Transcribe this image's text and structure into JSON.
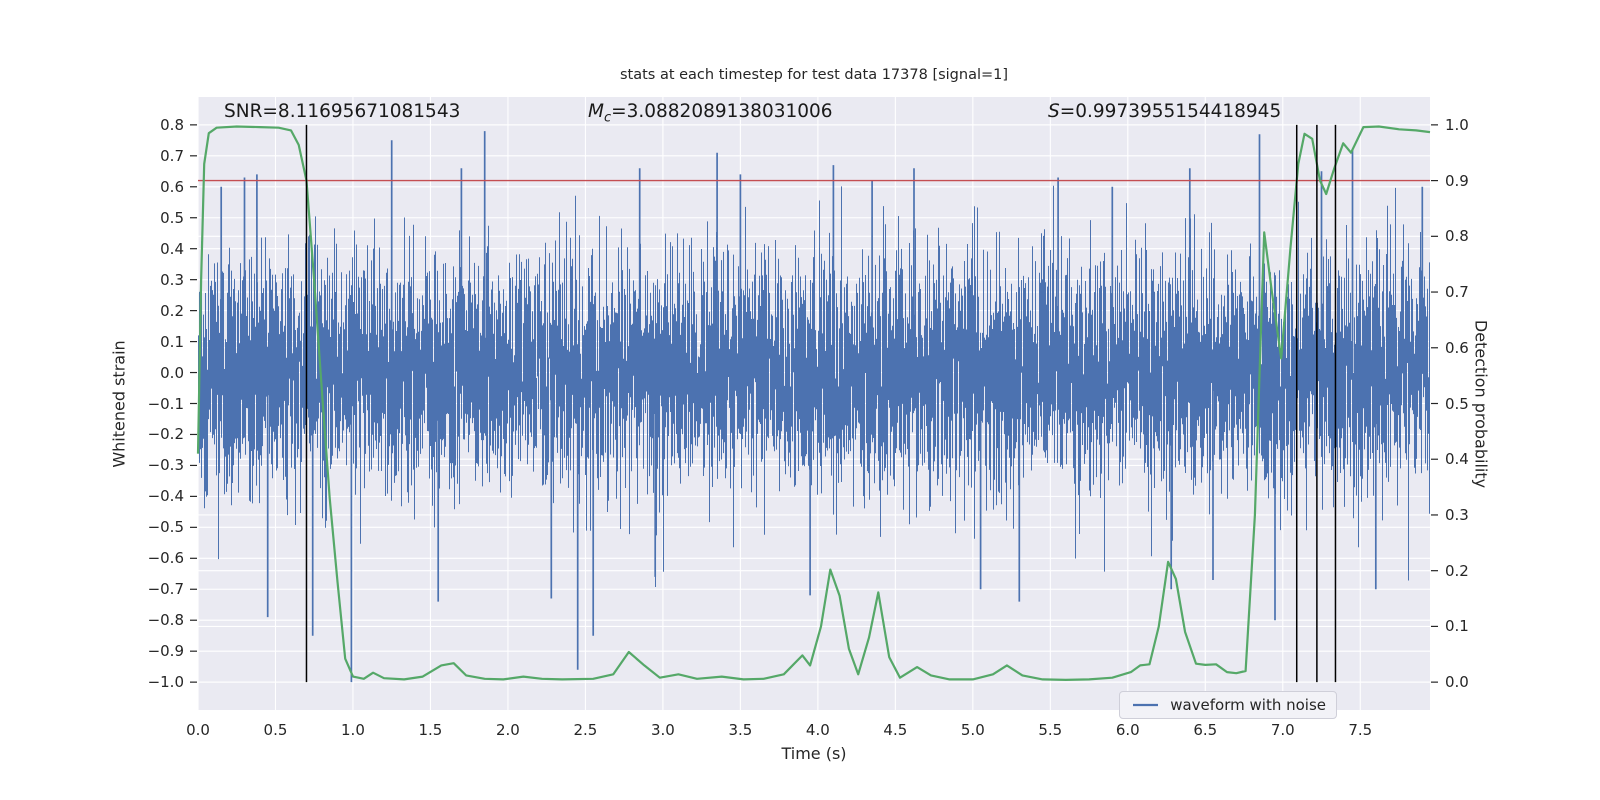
{
  "figure": {
    "title": "stats at each timestep for test data 17378 [signal=1]"
  },
  "annotations": {
    "snr": "SNR=8.11695671081543",
    "mc_symbol": "M",
    "mc_subscript": "c",
    "mc_value": "=3.0882089138031006",
    "s_symbol": "S",
    "s_value": "=0.9973955154418945"
  },
  "axes": {
    "xlabel": "Time (s)",
    "ylabel_left": "Whitened strain",
    "ylabel_right": "Detection probability",
    "xtick_labels": [
      "0.0",
      "0.5",
      "1.0",
      "1.5",
      "2.0",
      "2.5",
      "3.0",
      "3.5",
      "4.0",
      "4.5",
      "5.0",
      "5.5",
      "6.0",
      "6.5",
      "7.0",
      "7.5"
    ],
    "left_tick_labels": [
      "0.8",
      "0.7",
      "0.6",
      "0.5",
      "0.4",
      "0.3",
      "0.2",
      "0.1",
      "0.0",
      "−0.1",
      "−0.2",
      "−0.3",
      "−0.4",
      "−0.5",
      "−0.6",
      "−0.7",
      "−0.8",
      "−0.9",
      "−1.0"
    ],
    "right_tick_labels": [
      "1.0",
      "0.9",
      "0.8",
      "0.7",
      "0.6",
      "0.5",
      "0.4",
      "0.3",
      "0.2",
      "0.1",
      "0.0"
    ]
  },
  "legend": {
    "label": "waveform with noise"
  },
  "colors": {
    "figure_background": "#ffffff",
    "axes_background": "#eaeaf2",
    "grid": "#ffffff",
    "noise": "#4c72b0",
    "probability": "#55a868",
    "threshold": "#c44e52",
    "marker": "#000000",
    "text": "#262626"
  },
  "chart_data": {
    "type": "line",
    "title": "stats at each timestep for test data 17378 [signal=1]",
    "xlabel": "Time (s)",
    "ylabel_left": "Whitened strain",
    "ylabel_right": "Detection probability",
    "xlim": [
      0,
      7.95
    ],
    "ylim_left": [
      -1.09,
      0.89
    ],
    "ylim_right": [
      -0.05,
      1.05
    ],
    "grid": true,
    "legend_position": "lower right",
    "stats": {
      "SNR": 8.11695671081543,
      "chirp_mass": 3.0882089138031006,
      "score": 0.9973955154418945,
      "signal": 1,
      "test_data_id": 17378
    },
    "threshold_line": {
      "name": "detection threshold",
      "axis": "right",
      "y": 0.9
    },
    "event_markers": {
      "name": "event markers",
      "axis": "right",
      "x_values": [
        0.7,
        7.09,
        7.22,
        7.34
      ],
      "y_span": [
        0.0,
        1.0
      ]
    },
    "noise_series": {
      "name": "waveform with noise",
      "axis": "left",
      "style": "dense-gaussian-noise",
      "mean": 0,
      "approx_std": 0.185,
      "range": [
        -1.0,
        0.8
      ],
      "samples_per_column": 6,
      "seed": 17378,
      "notable_spikes": [
        [
          0.15,
          0.6
        ],
        [
          0.3,
          0.63
        ],
        [
          0.38,
          0.64
        ],
        [
          0.45,
          -0.79
        ],
        [
          0.74,
          -0.85
        ],
        [
          0.99,
          -1.0
        ],
        [
          1.25,
          0.75
        ],
        [
          1.55,
          -0.74
        ],
        [
          1.7,
          0.66
        ],
        [
          1.85,
          0.78
        ],
        [
          2.28,
          -0.73
        ],
        [
          2.45,
          -0.96
        ],
        [
          2.55,
          -0.85
        ],
        [
          2.85,
          0.66
        ],
        [
          2.95,
          -0.66
        ],
        [
          3.35,
          0.71
        ],
        [
          3.5,
          0.64
        ],
        [
          3.95,
          -0.72
        ],
        [
          4.1,
          0.67
        ],
        [
          4.35,
          0.62
        ],
        [
          4.62,
          0.66
        ],
        [
          5.05,
          -0.7
        ],
        [
          5.3,
          -0.74
        ],
        [
          5.55,
          0.63
        ],
        [
          5.9,
          0.6
        ],
        [
          6.28,
          -0.7
        ],
        [
          6.4,
          0.66
        ],
        [
          6.55,
          -0.67
        ],
        [
          6.85,
          0.77
        ],
        [
          6.95,
          -0.8
        ],
        [
          7.25,
          0.65
        ],
        [
          7.45,
          0.72
        ],
        [
          7.6,
          -0.7
        ],
        [
          7.9,
          0.6
        ]
      ]
    },
    "probability_series": {
      "name": "detection probability",
      "axis": "right",
      "points": [
        [
          0.0,
          0.41
        ],
        [
          0.02,
          0.72
        ],
        [
          0.04,
          0.93
        ],
        [
          0.07,
          0.985
        ],
        [
          0.12,
          0.995
        ],
        [
          0.25,
          0.997
        ],
        [
          0.4,
          0.996
        ],
        [
          0.52,
          0.995
        ],
        [
          0.6,
          0.99
        ],
        [
          0.65,
          0.964
        ],
        [
          0.7,
          0.9
        ],
        [
          0.75,
          0.72
        ],
        [
          0.8,
          0.52
        ],
        [
          0.85,
          0.33
        ],
        [
          0.9,
          0.18
        ],
        [
          0.95,
          0.042
        ],
        [
          1.0,
          0.01
        ],
        [
          1.07,
          0.006
        ],
        [
          1.13,
          0.017
        ],
        [
          1.2,
          0.007
        ],
        [
          1.33,
          0.005
        ],
        [
          1.45,
          0.01
        ],
        [
          1.57,
          0.03
        ],
        [
          1.65,
          0.034
        ],
        [
          1.73,
          0.012
        ],
        [
          1.85,
          0.006
        ],
        [
          1.97,
          0.005
        ],
        [
          2.1,
          0.01
        ],
        [
          2.22,
          0.006
        ],
        [
          2.35,
          0.005
        ],
        [
          2.55,
          0.006
        ],
        [
          2.68,
          0.014
        ],
        [
          2.78,
          0.054
        ],
        [
          2.88,
          0.03
        ],
        [
          2.98,
          0.008
        ],
        [
          3.1,
          0.014
        ],
        [
          3.22,
          0.006
        ],
        [
          3.38,
          0.01
        ],
        [
          3.52,
          0.005
        ],
        [
          3.65,
          0.006
        ],
        [
          3.78,
          0.014
        ],
        [
          3.9,
          0.048
        ],
        [
          3.95,
          0.03
        ],
        [
          4.02,
          0.1
        ],
        [
          4.08,
          0.202
        ],
        [
          4.14,
          0.155
        ],
        [
          4.2,
          0.06
        ],
        [
          4.26,
          0.014
        ],
        [
          4.33,
          0.08
        ],
        [
          4.39,
          0.161
        ],
        [
          4.46,
          0.045
        ],
        [
          4.53,
          0.008
        ],
        [
          4.64,
          0.027
        ],
        [
          4.73,
          0.012
        ],
        [
          4.85,
          0.005
        ],
        [
          5.0,
          0.005
        ],
        [
          5.13,
          0.014
        ],
        [
          5.22,
          0.03
        ],
        [
          5.32,
          0.012
        ],
        [
          5.45,
          0.005
        ],
        [
          5.6,
          0.004
        ],
        [
          5.75,
          0.005
        ],
        [
          5.9,
          0.008
        ],
        [
          6.02,
          0.018
        ],
        [
          6.08,
          0.03
        ],
        [
          6.14,
          0.032
        ],
        [
          6.2,
          0.1
        ],
        [
          6.26,
          0.216
        ],
        [
          6.31,
          0.185
        ],
        [
          6.37,
          0.09
        ],
        [
          6.44,
          0.033
        ],
        [
          6.5,
          0.031
        ],
        [
          6.57,
          0.032
        ],
        [
          6.64,
          0.018
        ],
        [
          6.7,
          0.016
        ],
        [
          6.76,
          0.02
        ],
        [
          6.82,
          0.3
        ],
        [
          6.88,
          0.807
        ],
        [
          6.93,
          0.7
        ],
        [
          6.99,
          0.581
        ],
        [
          7.05,
          0.78
        ],
        [
          7.1,
          0.93
        ],
        [
          7.14,
          0.984
        ],
        [
          7.19,
          0.975
        ],
        [
          7.24,
          0.9
        ],
        [
          7.28,
          0.876
        ],
        [
          7.33,
          0.92
        ],
        [
          7.39,
          0.967
        ],
        [
          7.44,
          0.95
        ],
        [
          7.52,
          0.996
        ],
        [
          7.62,
          0.997
        ],
        [
          7.75,
          0.992
        ],
        [
          7.86,
          0.99
        ],
        [
          7.95,
          0.987
        ]
      ]
    }
  }
}
